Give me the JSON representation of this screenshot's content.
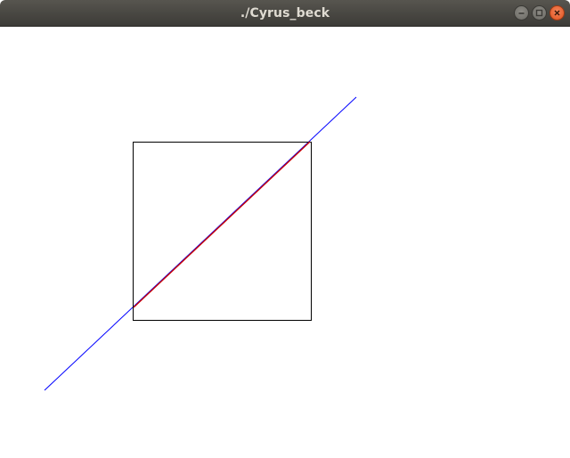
{
  "window": {
    "title": "./Cyrus_beck",
    "controls": [
      "minimize-icon",
      "maximize-icon",
      "close-icon"
    ]
  },
  "scene": {
    "clip_window_color": "#000000",
    "full_line_color": "#0000ff",
    "clipped_segment_color": "#cc0000"
  }
}
